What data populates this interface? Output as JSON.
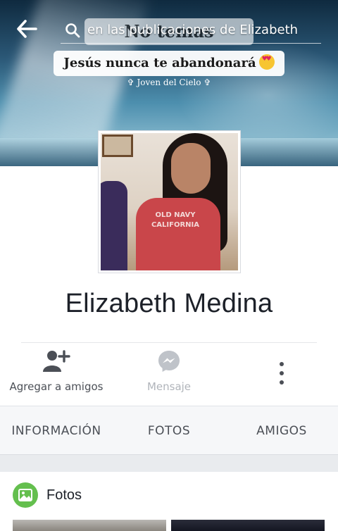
{
  "cover": {
    "title": "No temas",
    "quote": "Jesús nunca te abandonará",
    "credit": "✞ Joven del Cielo ✞"
  },
  "search": {
    "placeholder": "en las publicaciones de Elizabeth"
  },
  "profile": {
    "name": "Elizabeth Medina",
    "photo_shirt_text": "OLD NAVY\nCALIFORNIA"
  },
  "actions": {
    "add_friend": "Agregar a amigos",
    "message": "Mensaje"
  },
  "tabs": [
    "INFORMACIÓN",
    "FOTOS",
    "AMIGOS"
  ],
  "photos": {
    "title": "Fotos"
  },
  "colors": {
    "accent_green": "#64bf4e",
    "tab_bg": "#f6f7f9",
    "section_gap": "#e9ebee"
  }
}
